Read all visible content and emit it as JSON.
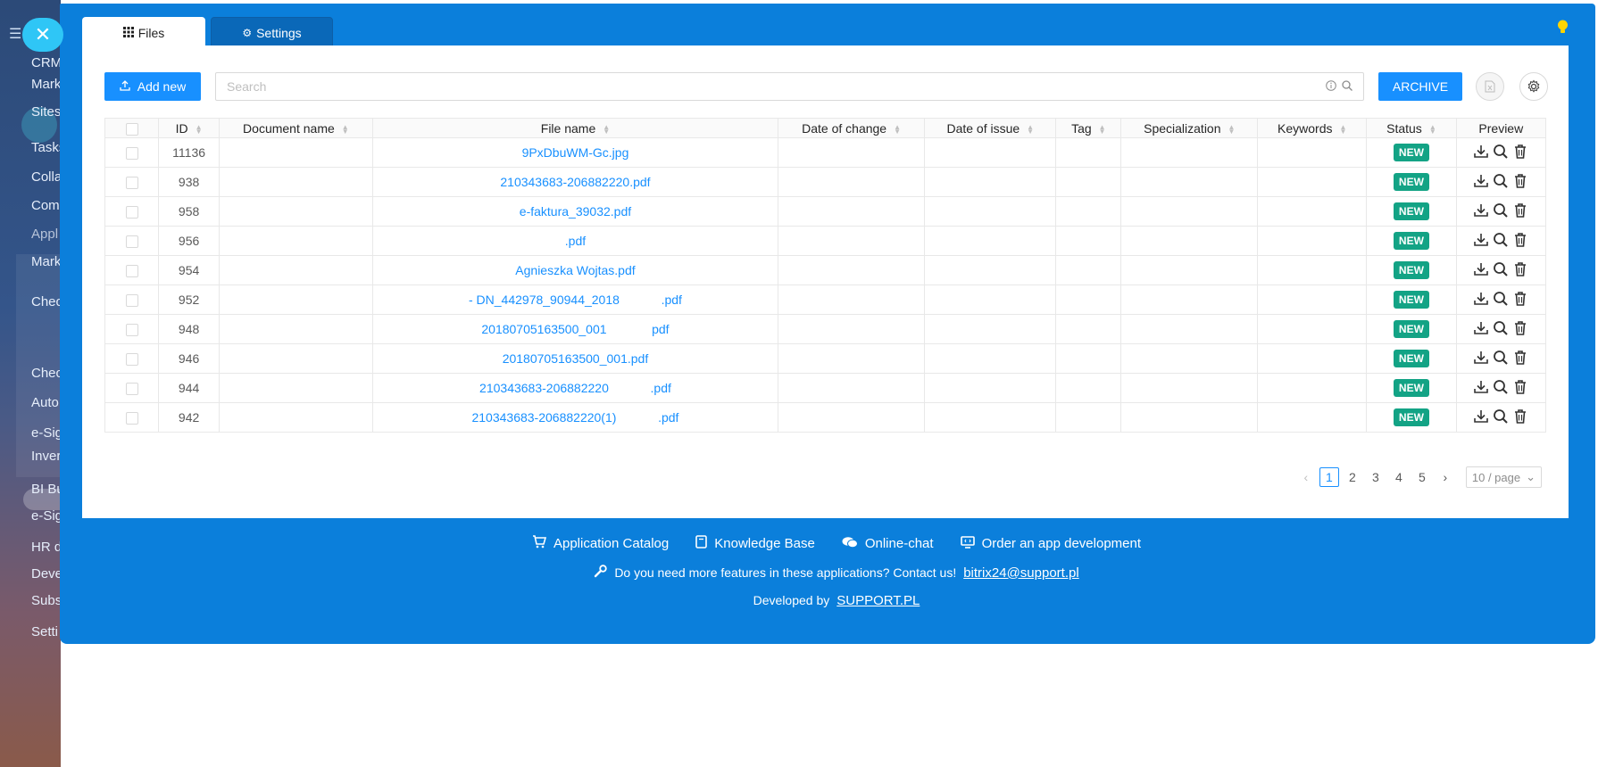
{
  "background_sidebar": {
    "items": [
      "CRM",
      "Mark",
      "Sites",
      "Tasks",
      "Colla",
      "Com",
      "Appl",
      "Mark",
      "Chec",
      "Chec",
      "Auto",
      "e-Sig",
      "Inver",
      "BI Bu",
      "e-Sig",
      "HR d",
      "Deve",
      "Subs",
      "Setti"
    ]
  },
  "tabs": [
    {
      "label": "Files",
      "icon": "grid-icon",
      "active": true
    },
    {
      "label": "Settings",
      "icon": "gear-icon",
      "active": false
    }
  ],
  "toolbar": {
    "add_new_label": "Add new",
    "search_placeholder": "Search",
    "archive_label": "ARCHIVE"
  },
  "table": {
    "columns": [
      "ID",
      "Document name",
      "File name",
      "Date of change",
      "Date of issue",
      "Tag",
      "Specialization",
      "Keywords",
      "Status",
      "Preview"
    ],
    "rows": [
      {
        "id": "11136",
        "doc": "",
        "file": "9PxDbuWM-Gc.jpg",
        "status": "NEW"
      },
      {
        "id": "938",
        "doc": "",
        "file": "210343683-206882220.pdf",
        "status": "NEW"
      },
      {
        "id": "958",
        "doc": "",
        "file": "e-faktura_39032.pdf",
        "status": "NEW"
      },
      {
        "id": "956",
        "doc": "",
        "file": ".pdf",
        "status": "NEW"
      },
      {
        "id": "954",
        "doc": "",
        "file": "Agnieszka Wojtas.pdf",
        "status": "NEW"
      },
      {
        "id": "952",
        "doc": "",
        "file": "- DN_442978_90944_2018            .pdf",
        "status": "NEW"
      },
      {
        "id": "948",
        "doc": "",
        "file": "20180705163500_001             pdf",
        "status": "NEW"
      },
      {
        "id": "946",
        "doc": "",
        "file": "20180705163500_001.pdf",
        "status": "NEW"
      },
      {
        "id": "944",
        "doc": "",
        "file": "210343683-206882220            .pdf",
        "status": "NEW"
      },
      {
        "id": "942",
        "doc": "",
        "file": "210343683-206882220(1)            .pdf",
        "status": "NEW"
      }
    ]
  },
  "pagination": {
    "pages": [
      "1",
      "2",
      "3",
      "4",
      "5"
    ],
    "current": "1",
    "page_size": "10 / page"
  },
  "footer": {
    "links": [
      {
        "label": "Application Catalog",
        "icon": "cart-icon"
      },
      {
        "label": "Knowledge Base",
        "icon": "book-icon"
      },
      {
        "label": "Online-chat",
        "icon": "chat-icon"
      },
      {
        "label": "Order an app development",
        "icon": "monitor-icon"
      }
    ],
    "contact_text": "Do you need more features in these applications? Contact us!",
    "contact_email": "bitrix24@support.pl",
    "developed_by": "Developed by",
    "developer": "SUPPORT.PL"
  },
  "colors": {
    "panel_blue": "#0b7fdb",
    "primary": "#1890ff",
    "status_green": "#13a385"
  }
}
